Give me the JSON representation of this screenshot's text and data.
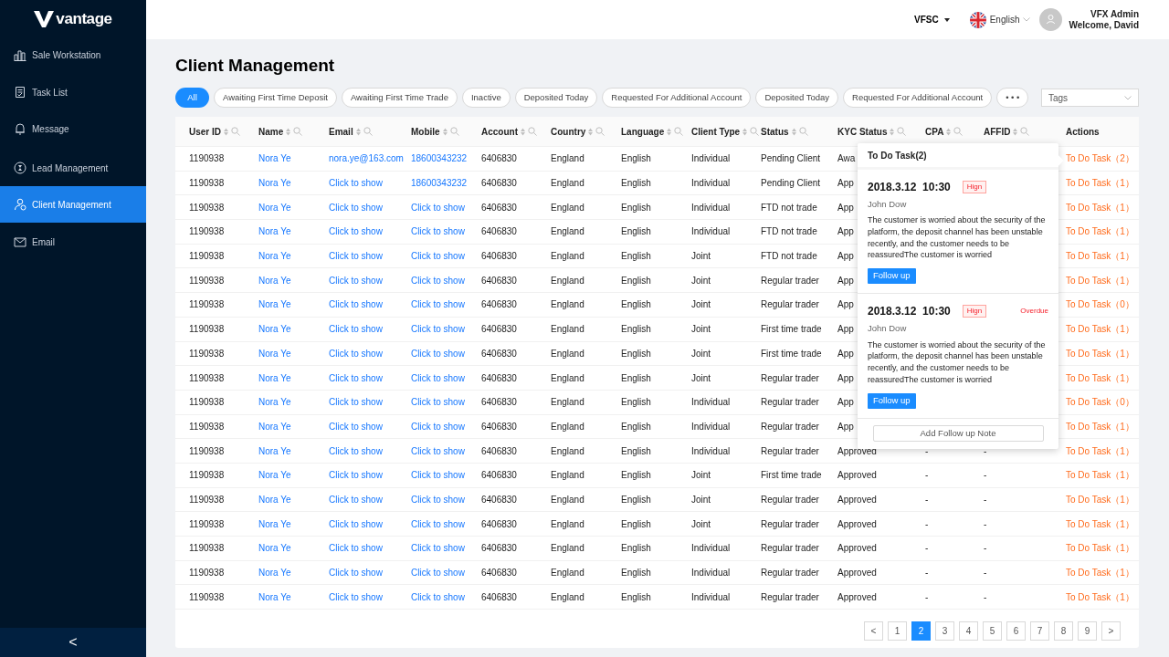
{
  "brand": "vantage",
  "sidebar": {
    "items": [
      {
        "label": "Sale Workstation",
        "selected": false
      },
      {
        "label": "Task List",
        "selected": false
      },
      {
        "label": "Message",
        "selected": false
      },
      {
        "label": "Lead Management",
        "selected": false
      },
      {
        "label": "Client Management",
        "selected": true
      },
      {
        "label": "Email",
        "selected": false
      }
    ],
    "collapse": "<"
  },
  "header": {
    "entity": "VFSC",
    "language": "English",
    "user_name": "VFX Admin",
    "welcome": "Welcome, David"
  },
  "title": "Client Management",
  "filters": [
    {
      "label": "All",
      "selected": true
    },
    {
      "label": "Awaiting First Time Deposit",
      "selected": false
    },
    {
      "label": "Awaiting First Time Trade",
      "selected": false
    },
    {
      "label": "Inactive",
      "selected": false
    },
    {
      "label": "Deposited Today",
      "selected": false
    },
    {
      "label": "Requested For Additional Account",
      "selected": false
    },
    {
      "label": "Deposited Today",
      "selected": false
    },
    {
      "label": "Requested For Additional Account",
      "selected": false
    },
    {
      "label": "• • •",
      "selected": false
    }
  ],
  "tags": {
    "placeholder": "Tags"
  },
  "table": {
    "columns": [
      {
        "label": "User ID",
        "sortable": true
      },
      {
        "label": "Name",
        "sortable": true
      },
      {
        "label": "Email",
        "sortable": true
      },
      {
        "label": "Mobile",
        "sortable": true
      },
      {
        "label": "Account",
        "sortable": true
      },
      {
        "label": "Country",
        "sortable": true
      },
      {
        "label": "Language",
        "sortable": true
      },
      {
        "label": "Client Type",
        "sortable": true
      },
      {
        "label": "Status",
        "sortable": true
      },
      {
        "label": "KYC Status",
        "sortable": true
      },
      {
        "label": "CPA",
        "sortable": true
      },
      {
        "label": "AFFID",
        "sortable": true
      },
      {
        "label": "Actions",
        "sortable": false
      }
    ],
    "rows": [
      {
        "user_id": "1190938",
        "name": "Nora Ye",
        "email": "nora.ye@163.com",
        "mobile": "18600343232",
        "account": "6406830",
        "country": "England",
        "language": "English",
        "client_type": "Individual",
        "status": "Pending Client",
        "kyc": "Awa",
        "action": "To Do Task（2）"
      },
      {
        "user_id": "1190938",
        "name": "Nora Ye",
        "email": "Click to show",
        "mobile": "18600343232",
        "account": "6406830",
        "country": "England",
        "language": "English",
        "client_type": "Individual",
        "status": "Pending Client",
        "kyc": "App",
        "action": "To Do Task（1）"
      },
      {
        "user_id": "1190938",
        "name": "Nora Ye",
        "email": "Click to show",
        "mobile": "Click to show",
        "account": "6406830",
        "country": "England",
        "language": "English",
        "client_type": "Individual",
        "status": "FTD not trade",
        "kyc": "App",
        "action": "To Do Task（1）"
      },
      {
        "user_id": "1190938",
        "name": "Nora Ye",
        "email": "Click to show",
        "mobile": "Click to show",
        "account": "6406830",
        "country": "England",
        "language": "English",
        "client_type": "Individual",
        "status": "FTD not trade",
        "kyc": "App",
        "action": "To Do Task（1）"
      },
      {
        "user_id": "1190938",
        "name": "Nora Ye",
        "email": "Click to show",
        "mobile": "Click to show",
        "account": "6406830",
        "country": "England",
        "language": "English",
        "client_type": "Joint",
        "status": "FTD not trade",
        "kyc": "App",
        "action": "To Do Task（1）"
      },
      {
        "user_id": "1190938",
        "name": "Nora Ye",
        "email": "Click to show",
        "mobile": "Click to show",
        "account": "6406830",
        "country": "England",
        "language": "English",
        "client_type": "Joint",
        "status": "Regular trader",
        "kyc": "App",
        "action": "To Do Task（1）"
      },
      {
        "user_id": "1190938",
        "name": "Nora Ye",
        "email": "Click to show",
        "mobile": "Click to show",
        "account": "6406830",
        "country": "England",
        "language": "English",
        "client_type": "Joint",
        "status": "Regular trader",
        "kyc": "App",
        "action": "To Do Task（0）"
      },
      {
        "user_id": "1190938",
        "name": "Nora Ye",
        "email": "Click to show",
        "mobile": "Click to show",
        "account": "6406830",
        "country": "England",
        "language": "English",
        "client_type": "Joint",
        "status": "First time trade",
        "kyc": "App",
        "action": "To Do Task（1）"
      },
      {
        "user_id": "1190938",
        "name": "Nora Ye",
        "email": "Click to show",
        "mobile": "Click to show",
        "account": "6406830",
        "country": "England",
        "language": "English",
        "client_type": "Joint",
        "status": "First time trade",
        "kyc": "App",
        "action": "To Do Task（1）"
      },
      {
        "user_id": "1190938",
        "name": "Nora Ye",
        "email": "Click to show",
        "mobile": "Click to show",
        "account": "6406830",
        "country": "England",
        "language": "English",
        "client_type": "Joint",
        "status": "Regular trader",
        "kyc": "App",
        "action": "To Do Task（1）"
      },
      {
        "user_id": "1190938",
        "name": "Nora Ye",
        "email": "Click to show",
        "mobile": "Click to show",
        "account": "6406830",
        "country": "England",
        "language": "English",
        "client_type": "Individual",
        "status": "Regular trader",
        "kyc": "App",
        "action": "To Do Task（0）"
      },
      {
        "user_id": "1190938",
        "name": "Nora Ye",
        "email": "Click to show",
        "mobile": "Click to show",
        "account": "6406830",
        "country": "England",
        "language": "English",
        "client_type": "Individual",
        "status": "Regular trader",
        "kyc": "App",
        "action": "To Do Task（1）"
      },
      {
        "user_id": "1190938",
        "name": "Nora Ye",
        "email": "Click to show",
        "mobile": "Click to show",
        "account": "6406830",
        "country": "England",
        "language": "English",
        "client_type": "Individual",
        "status": "Regular trader",
        "kyc": "Approved",
        "cpa": "-",
        "affid": "-",
        "action": "To Do Task（1）"
      },
      {
        "user_id": "1190938",
        "name": "Nora Ye",
        "email": "Click to show",
        "mobile": "Click to show",
        "account": "6406830",
        "country": "England",
        "language": "English",
        "client_type": "Joint",
        "status": "First time trade",
        "kyc": "Approved",
        "cpa": "-",
        "affid": "-",
        "action": "To Do Task（1）"
      },
      {
        "user_id": "1190938",
        "name": "Nora Ye",
        "email": "Click to show",
        "mobile": "Click to show",
        "account": "6406830",
        "country": "England",
        "language": "English",
        "client_type": "Joint",
        "status": "Regular trader",
        "kyc": "Approved",
        "cpa": "-",
        "affid": "-",
        "action": "To Do Task（1）"
      },
      {
        "user_id": "1190938",
        "name": "Nora Ye",
        "email": "Click to show",
        "mobile": "Click to show",
        "account": "6406830",
        "country": "England",
        "language": "English",
        "client_type": "Joint",
        "status": "Regular trader",
        "kyc": "Approved",
        "cpa": "-",
        "affid": "-",
        "action": "To Do Task（1）"
      },
      {
        "user_id": "1190938",
        "name": "Nora Ye",
        "email": "Click to show",
        "mobile": "Click to show",
        "account": "6406830",
        "country": "England",
        "language": "English",
        "client_type": "Individual",
        "status": "Regular trader",
        "kyc": "Approved",
        "cpa": "-",
        "affid": "-",
        "action": "To Do Task（1）"
      },
      {
        "user_id": "1190938",
        "name": "Nora Ye",
        "email": "Click to show",
        "mobile": "Click to show",
        "account": "6406830",
        "country": "England",
        "language": "English",
        "client_type": "Individual",
        "status": "Regular trader",
        "kyc": "Approved",
        "cpa": "-",
        "affid": "-",
        "action": "To Do Task（1）"
      },
      {
        "user_id": "1190938",
        "name": "Nora Ye",
        "email": "Click to show",
        "mobile": "Click to show",
        "account": "6406830",
        "country": "England",
        "language": "English",
        "client_type": "Individual",
        "status": "Regular trader",
        "kyc": "Approved",
        "cpa": "-",
        "affid": "-",
        "action": "To Do Task（1）"
      }
    ]
  },
  "task_popover": {
    "title": "To Do Task(2)",
    "tasks": [
      {
        "datetime": "2018.3.12  10:30",
        "priority": "Hign",
        "author": "John Dow",
        "text": "The customer is worried about the security of the platform, the deposit channel has been unstable recently, and the customer needs to be reassuredThe customer is worried",
        "button": "Follow up"
      },
      {
        "datetime": "2018.3.12  10:30",
        "priority": "Hign",
        "overdue": "Overdue",
        "author": "John Dow",
        "text": "The customer is worried about the security of the platform, the deposit channel has been unstable recently, and the customer needs to be reassuredThe customer is worried",
        "button": "Follow up"
      }
    ],
    "add_note": "Add Follow up Note"
  },
  "pagination": {
    "prev": "<",
    "next": ">",
    "pages": [
      {
        "label": "1",
        "selected": false
      },
      {
        "label": "2",
        "selected": true
      },
      {
        "label": "3",
        "selected": false
      },
      {
        "label": "4",
        "selected": false
      },
      {
        "label": "5",
        "selected": false
      },
      {
        "label": "6",
        "selected": false
      },
      {
        "label": "7",
        "selected": false
      },
      {
        "label": "8",
        "selected": false
      },
      {
        "label": "9",
        "selected": false
      }
    ]
  }
}
